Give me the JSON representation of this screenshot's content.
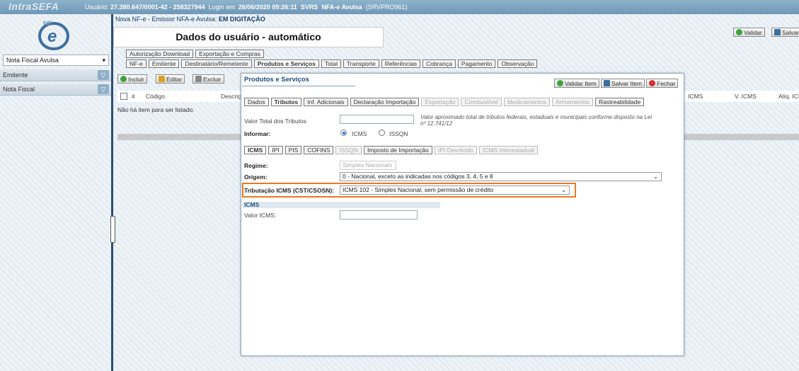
{
  "header": {
    "logo": "IntraSEFA",
    "user_info_prefix": "Usuário: ",
    "user_id": "27.380.647/0001-42 - 258327944",
    "login_prefix": "Login em: ",
    "login_date": "26/06/2020 09:26:11",
    "system": "SVRS",
    "module": "NFA-e Avulsa",
    "server": "(SRVPRO961)"
  },
  "sidebar": {
    "select_value": "Nota Fiscal Avulsa",
    "items": [
      {
        "label": "Emitente"
      },
      {
        "label": "Nota Fiscal"
      }
    ]
  },
  "document": {
    "title_prefix": "Nova NF-e - Emissor NFA-e Avulsa: ",
    "status": "EM DIGITAÇÃO"
  },
  "overlay": {
    "text": "Dados do usuário - automático"
  },
  "top_actions": {
    "validar": "Validar",
    "salvar": "Salvar"
  },
  "main_tabs_row1": [
    {
      "label": "Autorização Download"
    },
    {
      "label": "Exportação e Compras"
    }
  ],
  "main_tabs_row2": [
    {
      "label": "NF-e"
    },
    {
      "label": "Emitente"
    },
    {
      "label": "Destinatário/Remetente"
    },
    {
      "label": "Produtos e Serviços"
    },
    {
      "label": "Total"
    },
    {
      "label": "Transporte"
    },
    {
      "label": "Referências"
    },
    {
      "label": "Cobrança"
    },
    {
      "label": "Pagamento"
    },
    {
      "label": "Observação"
    }
  ],
  "toolbar": {
    "incluir": "Incluir",
    "editar": "Editar",
    "excluir": "Excluir"
  },
  "grid": {
    "columns": [
      "#",
      "Código",
      "Descriç",
      "ICMS",
      "V. ICMS",
      "Alíq. ICI"
    ],
    "empty_message": "Não há item para ser listado."
  },
  "modal": {
    "title": "Produtos e Serviços",
    "validar_item": "Validar Item",
    "salvar_item": "Salvar Item",
    "fechar": "Fechar",
    "tabs": [
      {
        "label": "Dados",
        "state": "normal"
      },
      {
        "label": "Tributos",
        "state": "active"
      },
      {
        "label": "Inf. Adicionais",
        "state": "normal"
      },
      {
        "label": "Declaração Importação",
        "state": "normal"
      },
      {
        "label": "Exportação",
        "state": "disabled"
      },
      {
        "label": "Combustível",
        "state": "disabled"
      },
      {
        "label": "Medicamentos",
        "state": "disabled"
      },
      {
        "label": "Armamentos",
        "state": "disabled"
      },
      {
        "label": "Rastreabilidade",
        "state": "normal"
      }
    ],
    "valor_total_label": "Valor Total dos Tributos",
    "valor_total_note": "Valor aproximado total de tributos federais, estaduais e municipais conforme disposto na Lei nº 12.741/12",
    "informar_label": "Informar:",
    "radio_icms": "ICMS",
    "radio_issqn": "ISSQN",
    "sub_tabs": [
      {
        "label": "ICMS",
        "state": "active"
      },
      {
        "label": "IPI",
        "state": "normal"
      },
      {
        "label": "PIS",
        "state": "normal"
      },
      {
        "label": "COFINS",
        "state": "normal"
      },
      {
        "label": "ISSQN",
        "state": "disabled"
      },
      {
        "label": "Imposto de Importação",
        "state": "normal"
      },
      {
        "label": "IPI Devolvido",
        "state": "disabled"
      },
      {
        "label": "ICMS Interestadual",
        "state": "disabled"
      }
    ],
    "regime_label": "Regime:",
    "regime_value": "Simples Nacional",
    "origem_label": "Origem:",
    "origem_value": "0 - Nacional, exceto as indicadas nos códigos 3, 4, 5 e 8",
    "tributacao_label": "Tributação ICMS (CST/CSOSN):",
    "tributacao_value": "ICMS 102 - Simples Nacional, sem permissão de crédito",
    "icms_section": "ICMS",
    "valor_icms_label": "Valor ICMS:"
  },
  "colors": {
    "topbar": "#6f98b6",
    "highlight": "#e87a22",
    "title_blue": "#1a4d80"
  }
}
